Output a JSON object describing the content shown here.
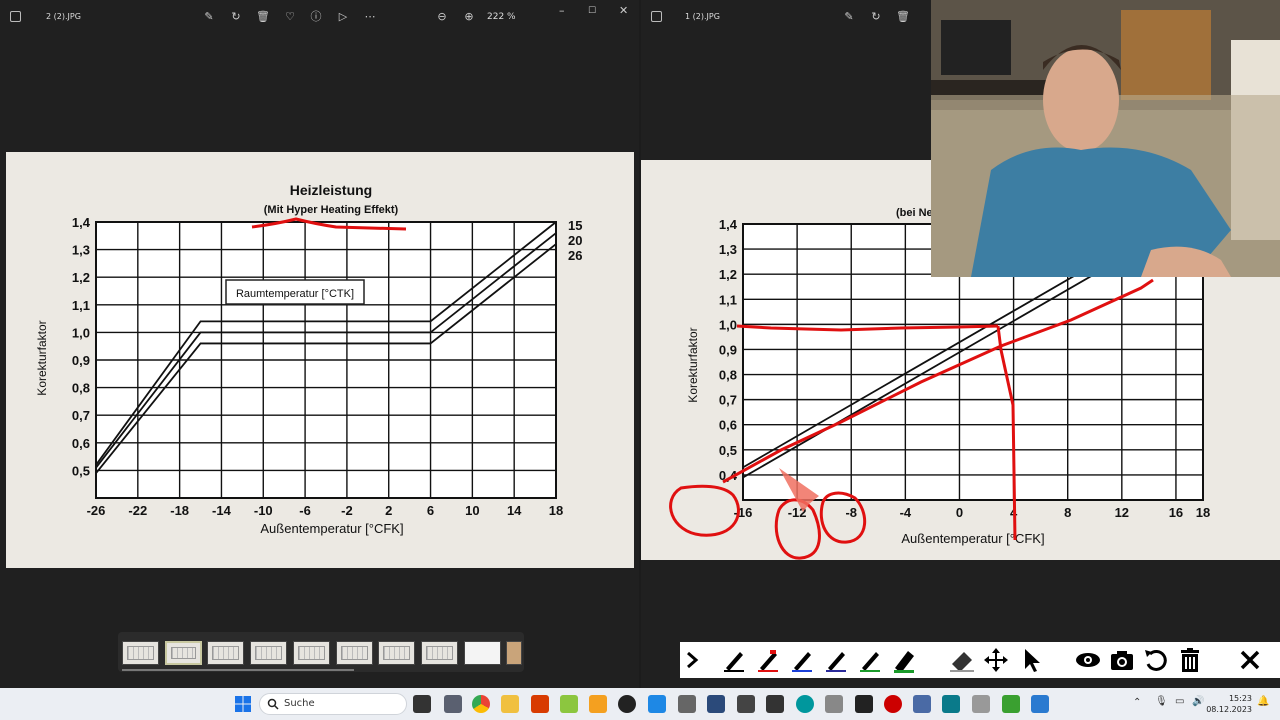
{
  "left_window": {
    "filename": "2 (2).JPG",
    "zoom": "222 %",
    "chart_title": "Heizleistung",
    "chart_subtitle": "(Mit Hyper Heating Effekt)",
    "annotation_box": "Raumtemperatur [°CTK]",
    "ylabel": "Korekturfaktor",
    "xlabel": "Außentemperatur [°CFK]",
    "x_ticks": [
      "-26",
      "-22",
      "-18",
      "-14",
      "-10",
      "-6",
      "-2",
      "2",
      "6",
      "10",
      "14",
      "18"
    ],
    "y_ticks": [
      "1,4",
      "1,3",
      "1,2",
      "1,1",
      "1,0",
      "0,9",
      "0,8",
      "0,7",
      "0,6",
      "0,5"
    ],
    "series_labels": [
      "15",
      "20",
      "26"
    ]
  },
  "right_window": {
    "filename": "1 (2).JPG",
    "chart_subtitle_partial": "(bei Ne",
    "ylabel": "Korekturfaktor",
    "xlabel": "Außentemperatur [°CFK]",
    "x_ticks": [
      "-16",
      "-12",
      "-8",
      "-4",
      "0",
      "4",
      "8",
      "12",
      "16",
      "18"
    ],
    "y_ticks": [
      "1,4",
      "1,3",
      "1,2",
      "1,1",
      "1,0",
      "0,9",
      "0,8",
      "0,7",
      "0,6",
      "0,5",
      "0,4"
    ]
  },
  "taskbar": {
    "search_placeholder": "Suche",
    "time": "15:23",
    "date": "08.12.2023"
  },
  "chart_data": [
    {
      "type": "line",
      "title": "Heizleistung",
      "subtitle": "(Mit Hyper Heating Effekt)",
      "xlabel": "Außentemperatur [°CFK]",
      "ylabel": "Korekturfaktor",
      "xlim": [
        -26,
        18
      ],
      "ylim": [
        0.4,
        1.4
      ],
      "grid": true,
      "series": [
        {
          "name": "15",
          "x": [
            -26,
            -16,
            6,
            18
          ],
          "y": [
            0.52,
            1.04,
            1.04,
            1.4
          ]
        },
        {
          "name": "20",
          "x": [
            -26,
            -16,
            6,
            18
          ],
          "y": [
            0.51,
            1.0,
            1.0,
            1.36
          ]
        },
        {
          "name": "26",
          "x": [
            -26,
            -16,
            6,
            18
          ],
          "y": [
            0.49,
            0.96,
            0.96,
            1.32
          ]
        }
      ]
    },
    {
      "type": "line",
      "xlabel": "Außentemperatur [°CFK]",
      "ylabel": "Korekturfaktor",
      "xlim": [
        -16,
        18
      ],
      "ylim": [
        0.3,
        1.4
      ],
      "grid": true,
      "series": [
        {
          "x": [
            -16,
            18
          ],
          "y": [
            0.43,
            1.49
          ]
        },
        {
          "x": [
            -16,
            18
          ],
          "y": [
            0.39,
            1.45
          ]
        }
      ]
    }
  ]
}
